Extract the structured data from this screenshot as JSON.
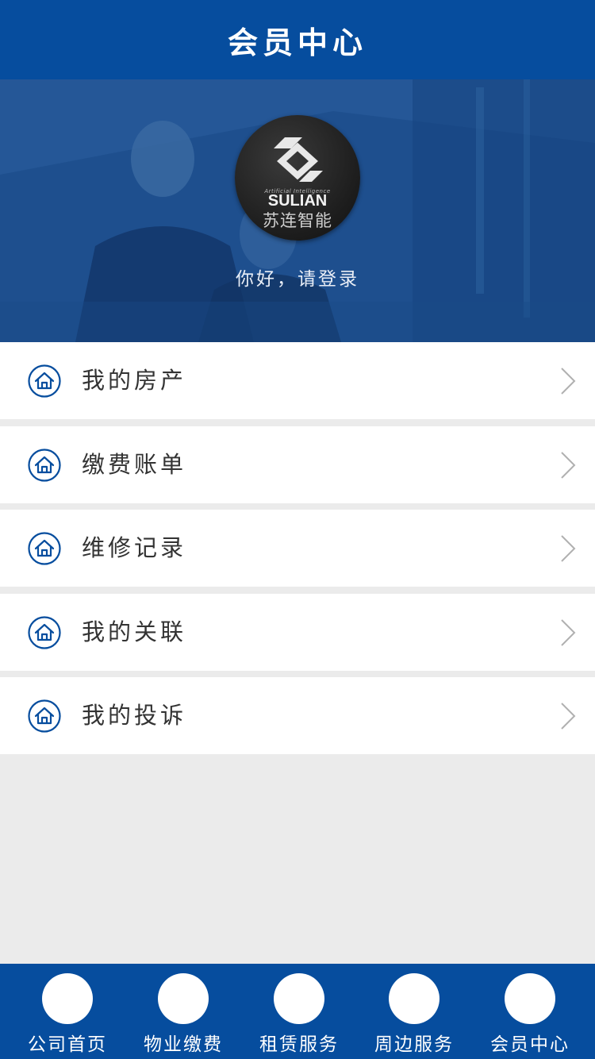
{
  "header": {
    "title": "会员中心"
  },
  "hero": {
    "logo": {
      "tagline": "Artificial Intelligence",
      "name_en": "SULIAN",
      "name_cn": "苏连智能"
    },
    "greeting": "你好，请登录"
  },
  "menu": [
    {
      "label": "我的房产",
      "icon": "home-icon"
    },
    {
      "label": "缴费账单",
      "icon": "home-icon"
    },
    {
      "label": "维修记录",
      "icon": "home-icon"
    },
    {
      "label": "我的关联",
      "icon": "home-icon"
    },
    {
      "label": "我的投诉",
      "icon": "home-icon"
    }
  ],
  "tabbar": [
    {
      "label": "公司首页"
    },
    {
      "label": "物业缴费"
    },
    {
      "label": "租赁服务"
    },
    {
      "label": "周边服务"
    },
    {
      "label": "会员中心"
    }
  ],
  "colors": {
    "primary": "#064d9e",
    "background": "#ebebeb",
    "text": "#333333"
  }
}
